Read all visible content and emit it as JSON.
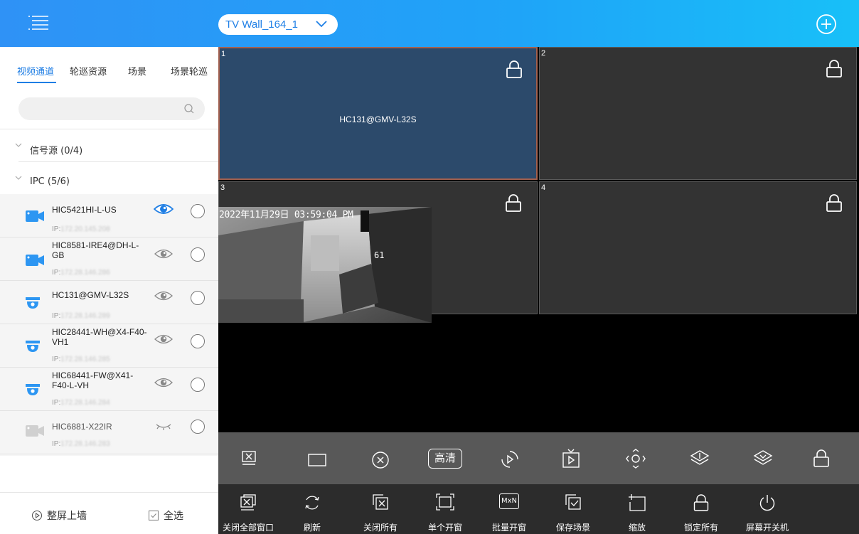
{
  "header": {
    "wall_name": "TV Wall_164_1"
  },
  "sidebar": {
    "tabs": [
      "视频通道",
      "轮巡资源",
      "场景",
      "场景轮巡"
    ],
    "search": {
      "placeholder": "",
      "value": ""
    },
    "groups": [
      {
        "label": "信号源 (0/4)"
      },
      {
        "label": "IPC (5/6)"
      }
    ],
    "devices": [
      {
        "name": "HIC5421HI-L-US",
        "ip_prefix": "IP:",
        "ip": "172.20.145.208",
        "eye": "active",
        "icon": "box-camera"
      },
      {
        "name": "HIC8581-IRE4@DH-L-GB",
        "ip_prefix": "IP:",
        "ip": "172.28.146.286",
        "eye": "inactive",
        "icon": "box-camera"
      },
      {
        "name": "HC131@GMV-L32S",
        "ip_prefix": "IP:",
        "ip": "172.28.146.289",
        "eye": "inactive",
        "icon": "dome-camera"
      },
      {
        "name": "HIC28441-WH@X4-F40-VH1",
        "ip_prefix": "IP:",
        "ip": "172.28.146.285",
        "eye": "inactive",
        "icon": "dome-camera"
      },
      {
        "name": "HIC68441-FW@X41-F40-L-VH",
        "ip_prefix": "IP:",
        "ip": "172.28.146.284",
        "eye": "inactive",
        "icon": "dome-camera"
      },
      {
        "name": "HIC6881-X22IR",
        "ip_prefix": "IP:",
        "ip": "172.28.146.283",
        "eye": "closed",
        "icon": "box-camera-offline"
      }
    ],
    "bottom": {
      "fullscreen_label": "整屏上墙",
      "select_all_label": "全选"
    }
  },
  "wall": {
    "cells": [
      {
        "number": "1",
        "channel": "HC131@GMV-L32S"
      },
      {
        "number": "2",
        "channel": ""
      },
      {
        "number": "3",
        "channel": ""
      },
      {
        "number": "4",
        "channel": ""
      }
    ],
    "video": {
      "timestamp": "2022年11月29日 03:59:04 PM",
      "overlay": "61"
    }
  },
  "toolbar": {
    "top_icons": [
      "close-window-icon",
      "single-window-icon",
      "close-circle-icon",
      "hd-icon",
      "playback-icon",
      "tv-play-icon",
      "ptz-icon",
      "layer-up-icon",
      "layer-down-icon",
      "lock-icon"
    ],
    "hd_label": "高清",
    "bottom_actions": [
      {
        "label": "关闭全部窗口",
        "icon": "close-all-windows-icon"
      },
      {
        "label": "刷新",
        "icon": "refresh-icon"
      },
      {
        "label": "关闭所有",
        "icon": "close-all-icon"
      },
      {
        "label": "单个开窗",
        "icon": "single-open-icon"
      },
      {
        "label": "批量开窗",
        "icon": "batch-open-icon"
      },
      {
        "label": "保存场景",
        "icon": "save-scene-icon"
      },
      {
        "label": "缩放",
        "icon": "zoom-icon"
      },
      {
        "label": "锁定所有",
        "icon": "lock-all-icon"
      },
      {
        "label": "屏幕开关机",
        "icon": "power-icon"
      }
    ],
    "batch_icon_text": "MxN"
  },
  "colors": {
    "topbar_start": "#2f92f6",
    "accent": "#1f7ee4",
    "selected_cell": "#2c4a6b",
    "cell_bg": "#333333",
    "toolbar_top": "#585858",
    "toolbar_bottom": "#2c2c2c"
  }
}
